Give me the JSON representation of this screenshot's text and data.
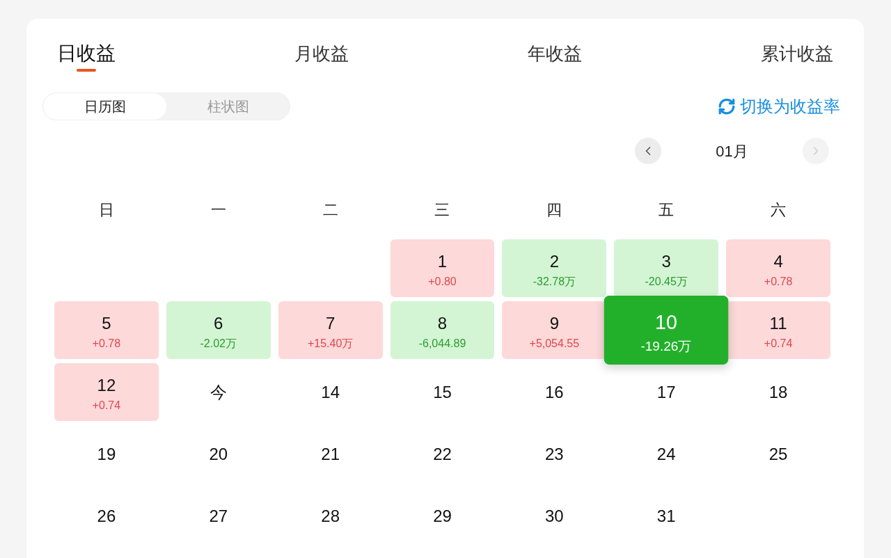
{
  "tabs": [
    {
      "label": "日收益",
      "selected": true
    },
    {
      "label": "月收益",
      "selected": false
    },
    {
      "label": "年收益",
      "selected": false
    },
    {
      "label": "累计收益",
      "selected": false
    }
  ],
  "chart_view": [
    {
      "label": "日历图",
      "selected": true
    },
    {
      "label": "柱状图",
      "selected": false
    }
  ],
  "rate_toggle": {
    "label": "切换为收益率"
  },
  "month_nav": {
    "prev": {
      "disabled": false
    },
    "label": "01月",
    "next": {
      "disabled": true
    }
  },
  "weekdays": [
    "日",
    "一",
    "二",
    "三",
    "四",
    "五",
    "六"
  ],
  "calendar": {
    "weeks": [
      {
        "cells": [
          {
            "kind": "blank"
          },
          {
            "kind": "blank"
          },
          {
            "kind": "blank"
          },
          {
            "kind": "gain",
            "day": "1",
            "value": "+0.80",
            "selected": false
          },
          {
            "kind": "loss",
            "day": "2",
            "value": "-32.78万",
            "selected": false
          },
          {
            "kind": "loss",
            "day": "3",
            "value": "-20.45万",
            "selected": false
          },
          {
            "kind": "gain",
            "day": "4",
            "value": "+0.78",
            "selected": false
          }
        ]
      },
      {
        "cells": [
          {
            "kind": "gain",
            "day": "5",
            "value": "+0.78",
            "selected": false
          },
          {
            "kind": "loss",
            "day": "6",
            "value": "-2.02万",
            "selected": false
          },
          {
            "kind": "gain",
            "day": "7",
            "value": "+15.40万",
            "selected": false
          },
          {
            "kind": "loss",
            "day": "8",
            "value": "-6,044.89",
            "selected": false
          },
          {
            "kind": "gain",
            "day": "9",
            "value": "+5,054.55",
            "selected": false
          },
          {
            "kind": "loss",
            "day": "10",
            "value": "-19.26万",
            "selected": true
          },
          {
            "kind": "gain",
            "day": "11",
            "value": "+0.74",
            "selected": false
          }
        ]
      },
      {
        "cells": [
          {
            "kind": "gain",
            "day": "12",
            "value": "+0.74",
            "selected": false
          },
          {
            "kind": "plain",
            "day": "今",
            "selected": false
          },
          {
            "kind": "plain",
            "day": "14",
            "selected": false
          },
          {
            "kind": "plain",
            "day": "15",
            "selected": false
          },
          {
            "kind": "plain",
            "day": "16",
            "selected": false
          },
          {
            "kind": "plain",
            "day": "17",
            "selected": false
          },
          {
            "kind": "plain",
            "day": "18",
            "selected": false
          }
        ]
      },
      {
        "cells": [
          {
            "kind": "plain",
            "day": "19",
            "selected": false
          },
          {
            "kind": "plain",
            "day": "20",
            "selected": false
          },
          {
            "kind": "plain",
            "day": "21",
            "selected": false
          },
          {
            "kind": "plain",
            "day": "22",
            "selected": false
          },
          {
            "kind": "plain",
            "day": "23",
            "selected": false
          },
          {
            "kind": "plain",
            "day": "24",
            "selected": false
          },
          {
            "kind": "plain",
            "day": "25",
            "selected": false
          }
        ]
      },
      {
        "cells": [
          {
            "kind": "plain",
            "day": "26",
            "selected": false
          },
          {
            "kind": "plain",
            "day": "27",
            "selected": false
          },
          {
            "kind": "plain",
            "day": "28",
            "selected": false
          },
          {
            "kind": "plain",
            "day": "29",
            "selected": false
          },
          {
            "kind": "plain",
            "day": "30",
            "selected": false
          },
          {
            "kind": "plain",
            "day": "31",
            "selected": false
          },
          {
            "kind": "blank"
          }
        ]
      }
    ]
  }
}
